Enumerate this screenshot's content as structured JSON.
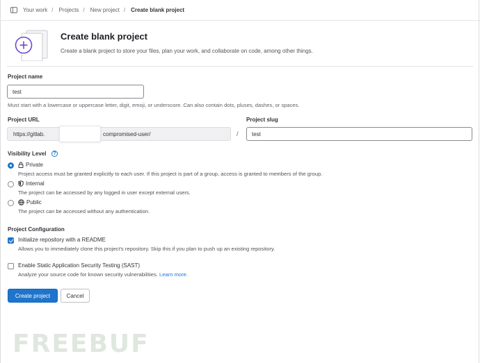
{
  "breadcrumb": {
    "items": [
      "Your work",
      "Projects",
      "New project"
    ],
    "current": "Create blank project"
  },
  "header": {
    "title": "Create blank project",
    "subtitle": "Create a blank project to store your files, plan your work, and collaborate on code, among other things."
  },
  "project_name": {
    "label": "Project name",
    "value": "test",
    "help": "Must start with a lowercase or uppercase letter, digit, emoji, or underscore. Can also contain dots, pluses, dashes, or spaces."
  },
  "project_url": {
    "label": "Project URL",
    "prefix": "https://gitlab.",
    "namespace": "compromised-user/",
    "separator": "/"
  },
  "project_slug": {
    "label": "Project slug",
    "value": "test"
  },
  "visibility": {
    "label": "Visibility Level",
    "help_icon": "question-circle-icon",
    "options": [
      {
        "label": "Private",
        "icon": "lock-icon",
        "checked": true,
        "description": "Project access must be granted explicitly to each user. If this project is part of a group, access is granted to members of the group."
      },
      {
        "label": "Internal",
        "icon": "shield-icon",
        "checked": false,
        "description": "The project can be accessed by any logged in user except external users."
      },
      {
        "label": "Public",
        "icon": "globe-icon",
        "checked": false,
        "description": "The project can be accessed without any authentication."
      }
    ]
  },
  "configuration": {
    "label": "Project Configuration",
    "readme": {
      "label": "Initialize repository with a README",
      "checked": true,
      "description": "Allows you to immediately clone this project's repository. Skip this if you plan to push up an existing repository."
    },
    "sast": {
      "label": "Enable Static Application Security Testing (SAST)",
      "checked": false,
      "description": "Analyze your source code for known security vulnerabilities.",
      "link": "Learn more."
    }
  },
  "actions": {
    "create": "Create project",
    "cancel": "Cancel"
  },
  "watermark": "FREEBUF",
  "colors": {
    "primary": "#1f75cb",
    "illustration_accent": "#6e49cb"
  }
}
